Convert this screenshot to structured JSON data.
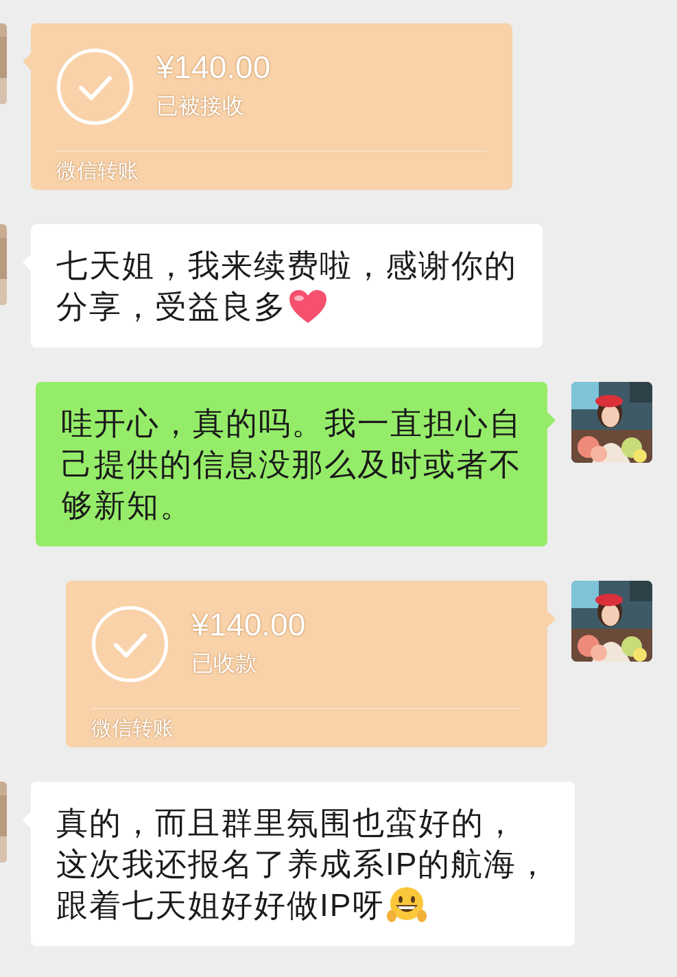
{
  "messages": [
    {
      "outgoing": false,
      "kind": "transfer",
      "amount": "¥140.00",
      "status": "已被接收",
      "label": "微信转账"
    },
    {
      "outgoing": false,
      "kind": "text",
      "lines": [
        "七天姐，我来续费啦，感谢你的",
        "分享，受益良多"
      ],
      "emoji": {
        "kind": "heart"
      }
    },
    {
      "outgoing": true,
      "kind": "text",
      "lines": [
        "哇开心，真的吗。我一直担心自",
        "己提供的信息没那么及时或者不",
        "够新知。"
      ]
    },
    {
      "outgoing": true,
      "kind": "transfer",
      "amount": "¥140.00",
      "status": "已收款",
      "label": "微信转账"
    },
    {
      "outgoing": false,
      "kind": "text",
      "lines": [
        "真的，而且群里氛围也蛮好的，",
        "这次我还报名了养成系IP的航海，",
        "跟着七天姐好好做IP呀"
      ],
      "emoji": {
        "kind": "grin"
      }
    }
  ]
}
